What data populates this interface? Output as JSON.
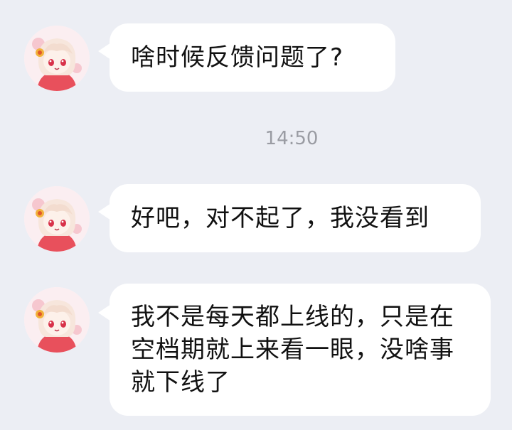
{
  "messages": [
    {
      "text": "啥时候反馈问题了?",
      "avatar_icon": "anime-girl-avatar-icon"
    },
    {
      "text": "好吧，对不起了，我没看到",
      "avatar_icon": "anime-girl-avatar-icon"
    },
    {
      "text": "我不是每天都上线的，只是在空档期就上来看一眼，没啥事就下线了",
      "avatar_icon": "anime-girl-avatar-icon"
    }
  ],
  "timestamp": "14:50",
  "colors": {
    "background": "#eceef4",
    "bubble": "#ffffff",
    "text": "#111111",
    "timestamp": "#9a9ca3"
  }
}
